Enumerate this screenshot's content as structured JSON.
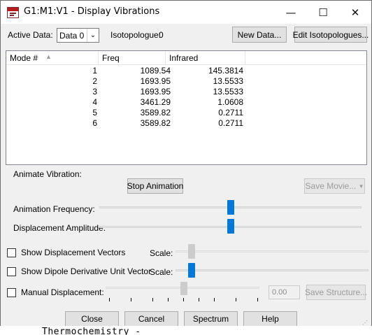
{
  "window": {
    "title": "G1:M1:V1 - Display Vibrations",
    "controls": {
      "minimize": "—",
      "maximize": "☐",
      "close": "✕"
    }
  },
  "top": {
    "active_data_label": "Active Data:",
    "active_data_value": "Data 0",
    "isotopologue_label": "Isotopologue:",
    "isotopologue_value": "0",
    "new_data_button": "New Data...",
    "edit_isotopologues_button": "Edit Isotopologues..."
  },
  "table": {
    "columns": [
      "Mode #",
      "Freq",
      "Infrared"
    ],
    "rows": [
      [
        "1",
        "1089.54",
        "145.3814"
      ],
      [
        "2",
        "1693.95",
        "13.5533"
      ],
      [
        "3",
        "1693.95",
        "13.5533"
      ],
      [
        "4",
        "3461.29",
        "1.0608"
      ],
      [
        "5",
        "3589.82",
        "0.2711"
      ],
      [
        "6",
        "3589.82",
        "0.2711"
      ]
    ]
  },
  "animate": {
    "section_label": "Animate Vibration:",
    "stop_animation_button": "Stop Animation",
    "save_movie_button": "Save Movie...",
    "animation_frequency_label": "Animation Frequency:",
    "displacement_amplitude_label": "Displacement Amplitude:",
    "animation_frequency_level": 0.5,
    "displacement_amplitude_level": 0.5
  },
  "options": {
    "show_displacement_vectors_label": "Show Displacement Vectors",
    "show_dipole_label": "Show Dipole Derivative Unit Vector",
    "scale_label": "Scale:",
    "manual_displacement_label": "Manual Displacement:",
    "manual_displacement_value": "0.00",
    "save_structure_button": "Save Structure..."
  },
  "buttons": {
    "close": "Close",
    "cancel": "Cancel",
    "spectrum": "Spectrum",
    "help": "Help"
  },
  "background": {
    "behind_text": "Thermochemistry -"
  },
  "colors": {
    "slider_thumb_active": "#0078d7",
    "slider_thumb_inactive": "#cccccc"
  }
}
